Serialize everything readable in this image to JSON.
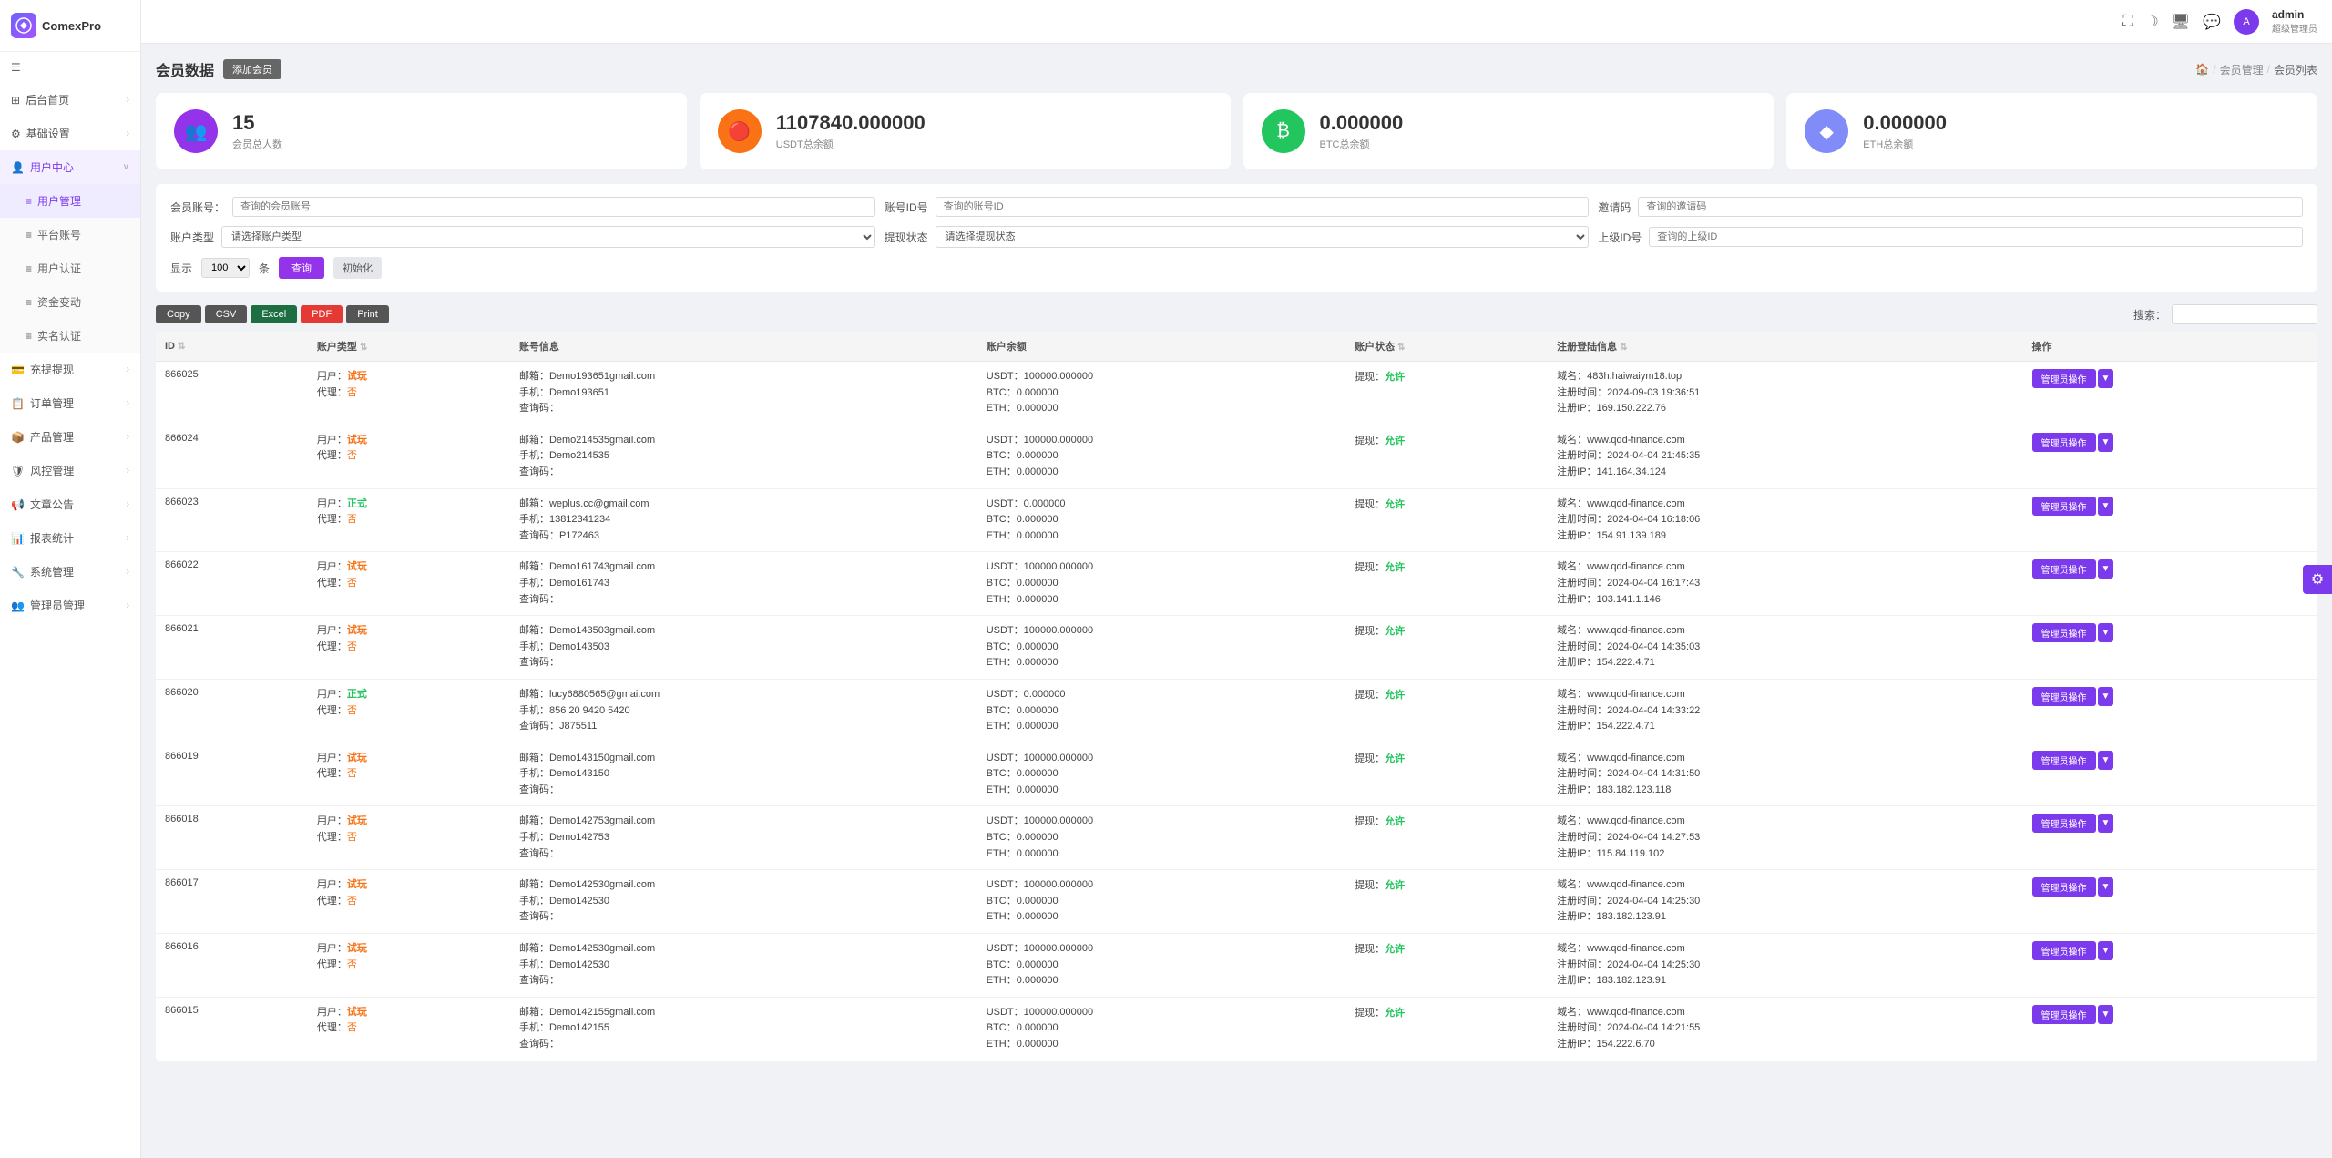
{
  "app": {
    "logo": "CP",
    "name": "ComexPro"
  },
  "header": {
    "icons": [
      "fullscreen",
      "theme",
      "monitor",
      "chat"
    ],
    "user": {
      "name": "admin",
      "role": "超级管理员"
    }
  },
  "sidebar": {
    "menu_icon": "☰",
    "items": [
      {
        "id": "dashboard",
        "icon": "⊞",
        "label": "后台首页",
        "has_arrow": true,
        "active": false
      },
      {
        "id": "basic-settings",
        "icon": "⚙",
        "label": "基础设置",
        "has_arrow": true,
        "active": false
      },
      {
        "id": "user-center",
        "icon": "👤",
        "label": "用户中心",
        "has_arrow": true,
        "active": true,
        "children": [
          {
            "id": "user-management",
            "label": "用户管理",
            "active": true
          },
          {
            "id": "platform-account",
            "label": "平台账号",
            "active": false
          },
          {
            "id": "user-auth",
            "label": "用户认证",
            "active": false
          },
          {
            "id": "fund-movement",
            "label": "资金变动",
            "active": false
          },
          {
            "id": "real-name",
            "label": "实名认证",
            "active": false
          }
        ]
      },
      {
        "id": "recharge",
        "icon": "💳",
        "label": "充提提现",
        "has_arrow": true,
        "active": false
      },
      {
        "id": "order-manage",
        "icon": "📋",
        "label": "订单管理",
        "has_arrow": true,
        "active": false
      },
      {
        "id": "product-manage",
        "icon": "📦",
        "label": "产品管理",
        "has_arrow": true,
        "active": false
      },
      {
        "id": "risk-control",
        "icon": "🛡",
        "label": "风控管理",
        "has_arrow": true,
        "active": false
      },
      {
        "id": "announcement",
        "icon": "📢",
        "label": "文章公告",
        "has_arrow": true,
        "active": false
      },
      {
        "id": "report-stats",
        "icon": "📊",
        "label": "报表统计",
        "has_arrow": true,
        "active": false
      },
      {
        "id": "system-manage",
        "icon": "🔧",
        "label": "系统管理",
        "has_arrow": true,
        "active": false
      },
      {
        "id": "admin-manage",
        "icon": "👥",
        "label": "管理员管理",
        "has_arrow": true,
        "active": false
      }
    ]
  },
  "page": {
    "title": "会员数据",
    "add_btn": "添加会员",
    "breadcrumb": [
      "🏠",
      "会员管理",
      "会员列表"
    ]
  },
  "stats": [
    {
      "id": "members",
      "icon": "👥",
      "icon_class": "purple",
      "value": "15",
      "label": "会员总人数"
    },
    {
      "id": "usdt",
      "icon": "🔴",
      "icon_class": "orange",
      "value": "1107840.000000",
      "label": "USDT总余额"
    },
    {
      "id": "btc",
      "icon": "₿",
      "icon_class": "green",
      "value": "0.000000",
      "label": "BTC总余额"
    },
    {
      "id": "eth",
      "icon": "◆",
      "icon_class": "blue",
      "value": "0.000000",
      "label": "ETH总余额"
    }
  ],
  "filters": {
    "member_account_label": "会员账号：",
    "member_account_placeholder": "查询的会员账号",
    "account_id_label": "账号ID号",
    "account_id_placeholder": "查询的账号ID",
    "invite_code_label": "邀请码",
    "invite_code_placeholder": "查询的邀请码",
    "superior_id_label": "上级ID号",
    "superior_id_placeholder": "查询的上级ID",
    "account_type_label": "账户类型",
    "account_type_placeholder": "请选择账户类型",
    "withdraw_status_label": "提现状态",
    "withdraw_status_placeholder": "请选择提现状态",
    "show_label": "显示",
    "show_value": "100",
    "show_unit": "条",
    "query_btn": "查询",
    "reset_btn": "初始化"
  },
  "toolbar": {
    "copy_btn": "Copy",
    "csv_btn": "CSV",
    "excel_btn": "Excel",
    "pdf_btn": "PDF",
    "print_btn": "Print",
    "search_label": "搜索：",
    "search_placeholder": ""
  },
  "table": {
    "columns": [
      "ID",
      "账户类型",
      "账号信息",
      "账户余额",
      "账户状态",
      "注册登陆信息",
      "操作"
    ],
    "rows": [
      {
        "id": "866025",
        "account_type_user": "试玩",
        "account_type_user_class": "tag-try",
        "account_type_agent": "否",
        "account_type_agent_class": "tag-no",
        "email": "Demo193651gmail.com",
        "phone": "Demo193651",
        "invite_code": "",
        "usdt": "100000.000000",
        "btc": "0.000000",
        "eth": "0.000000",
        "withdraw_status": "允许",
        "domain": "483h.haiwaiym18.top",
        "reg_time": "2024-09-03 19:36:51",
        "login_ip": "169.150.222.76"
      },
      {
        "id": "866024",
        "account_type_user": "试玩",
        "account_type_user_class": "tag-try",
        "account_type_agent": "否",
        "account_type_agent_class": "tag-no",
        "email": "Demo214535gmail.com",
        "phone": "Demo214535",
        "invite_code": "",
        "usdt": "100000.000000",
        "btc": "0.000000",
        "eth": "0.000000",
        "withdraw_status": "允许",
        "domain": "www.qdd-finance.com",
        "reg_time": "2024-04-04 21:45:35",
        "login_ip": "141.164.34.124"
      },
      {
        "id": "866023",
        "account_type_user": "正式",
        "account_type_user_class": "tag-official",
        "account_type_agent": "否",
        "account_type_agent_class": "tag-no",
        "email": "weplus.cc@gmail.com",
        "phone": "13812341234",
        "invite_code": "P172463",
        "usdt": "0.000000",
        "btc": "0.000000",
        "eth": "0.000000",
        "withdraw_status": "允许",
        "domain": "www.qdd-finance.com",
        "reg_time": "2024-04-04 16:18:06",
        "login_ip": "154.91.139.189"
      },
      {
        "id": "866022",
        "account_type_user": "试玩",
        "account_type_user_class": "tag-try",
        "account_type_agent": "否",
        "account_type_agent_class": "tag-no",
        "email": "Demo161743gmail.com",
        "phone": "Demo161743",
        "invite_code": "",
        "usdt": "100000.000000",
        "btc": "0.000000",
        "eth": "0.000000",
        "withdraw_status": "允许",
        "domain": "www.qdd-finance.com",
        "reg_time": "2024-04-04 16:17:43",
        "login_ip": "103.141.1.146"
      },
      {
        "id": "866021",
        "account_type_user": "试玩",
        "account_type_user_class": "tag-try",
        "account_type_agent": "否",
        "account_type_agent_class": "tag-no",
        "email": "Demo143503gmail.com",
        "phone": "Demo143503",
        "invite_code": "",
        "usdt": "100000.000000",
        "btc": "0.000000",
        "eth": "0.000000",
        "withdraw_status": "允许",
        "domain": "www.qdd-finance.com",
        "reg_time": "2024-04-04 14:35:03",
        "login_ip": "154.222.4.71"
      },
      {
        "id": "866020",
        "account_type_user": "正式",
        "account_type_user_class": "tag-official",
        "account_type_agent": "否",
        "account_type_agent_class": "tag-no",
        "email": "lucy6880565@gmai.com",
        "phone": "856 20 9420 5420",
        "invite_code": "J875511",
        "usdt": "0.000000",
        "btc": "0.000000",
        "eth": "0.000000",
        "withdraw_status": "允许",
        "domain": "www.qdd-finance.com",
        "reg_time": "2024-04-04 14:33:22",
        "login_ip": "154.222.4.71"
      },
      {
        "id": "866019",
        "account_type_user": "试玩",
        "account_type_user_class": "tag-try",
        "account_type_agent": "否",
        "account_type_agent_class": "tag-no",
        "email": "Demo143150gmail.com",
        "phone": "Demo143150",
        "invite_code": "",
        "usdt": "100000.000000",
        "btc": "0.000000",
        "eth": "0.000000",
        "withdraw_status": "允许",
        "domain": "www.qdd-finance.com",
        "reg_time": "2024-04-04 14:31:50",
        "login_ip": "183.182.123.118"
      },
      {
        "id": "866018",
        "account_type_user": "试玩",
        "account_type_user_class": "tag-try",
        "account_type_agent": "否",
        "account_type_agent_class": "tag-no",
        "email": "Demo142753gmail.com",
        "phone": "Demo142753",
        "invite_code": "",
        "usdt": "100000.000000",
        "btc": "0.000000",
        "eth": "0.000000",
        "withdraw_status": "允许",
        "domain": "www.qdd-finance.com",
        "reg_time": "2024-04-04 14:27:53",
        "login_ip": "115.84.119.102"
      },
      {
        "id": "866017",
        "account_type_user": "试玩",
        "account_type_user_class": "tag-try",
        "account_type_agent": "否",
        "account_type_agent_class": "tag-no",
        "email": "Demo142530gmail.com",
        "phone": "Demo142530",
        "invite_code": "",
        "usdt": "100000.000000",
        "btc": "0.000000",
        "eth": "0.000000",
        "withdraw_status": "允许",
        "domain": "www.qdd-finance.com",
        "reg_time": "2024-04-04 14:25:30",
        "login_ip": "183.182.123.91"
      },
      {
        "id": "866016",
        "account_type_user": "试玩",
        "account_type_user_class": "tag-try",
        "account_type_agent": "否",
        "account_type_agent_class": "tag-no",
        "email": "Demo142530gmail.com",
        "phone": "Demo142530",
        "invite_code": "",
        "usdt": "100000.000000",
        "btc": "0.000000",
        "eth": "0.000000",
        "withdraw_status": "允许",
        "domain": "www.qdd-finance.com",
        "reg_time": "2024-04-04 14:25:30",
        "login_ip": "183.182.123.91"
      },
      {
        "id": "866015",
        "account_type_user": "试玩",
        "account_type_user_class": "tag-try",
        "account_type_agent": "否",
        "account_type_agent_class": "tag-no",
        "email": "Demo142155gmail.com",
        "phone": "Demo142155",
        "invite_code": "",
        "usdt": "100000.000000",
        "btc": "0.000000",
        "eth": "0.000000",
        "withdraw_status": "允许",
        "domain": "www.qdd-finance.com",
        "reg_time": "2024-04-04 14:21:55",
        "login_ip": "154.222.6.70"
      }
    ],
    "action_btn": "管理员操作",
    "action_arrow": "▼"
  }
}
